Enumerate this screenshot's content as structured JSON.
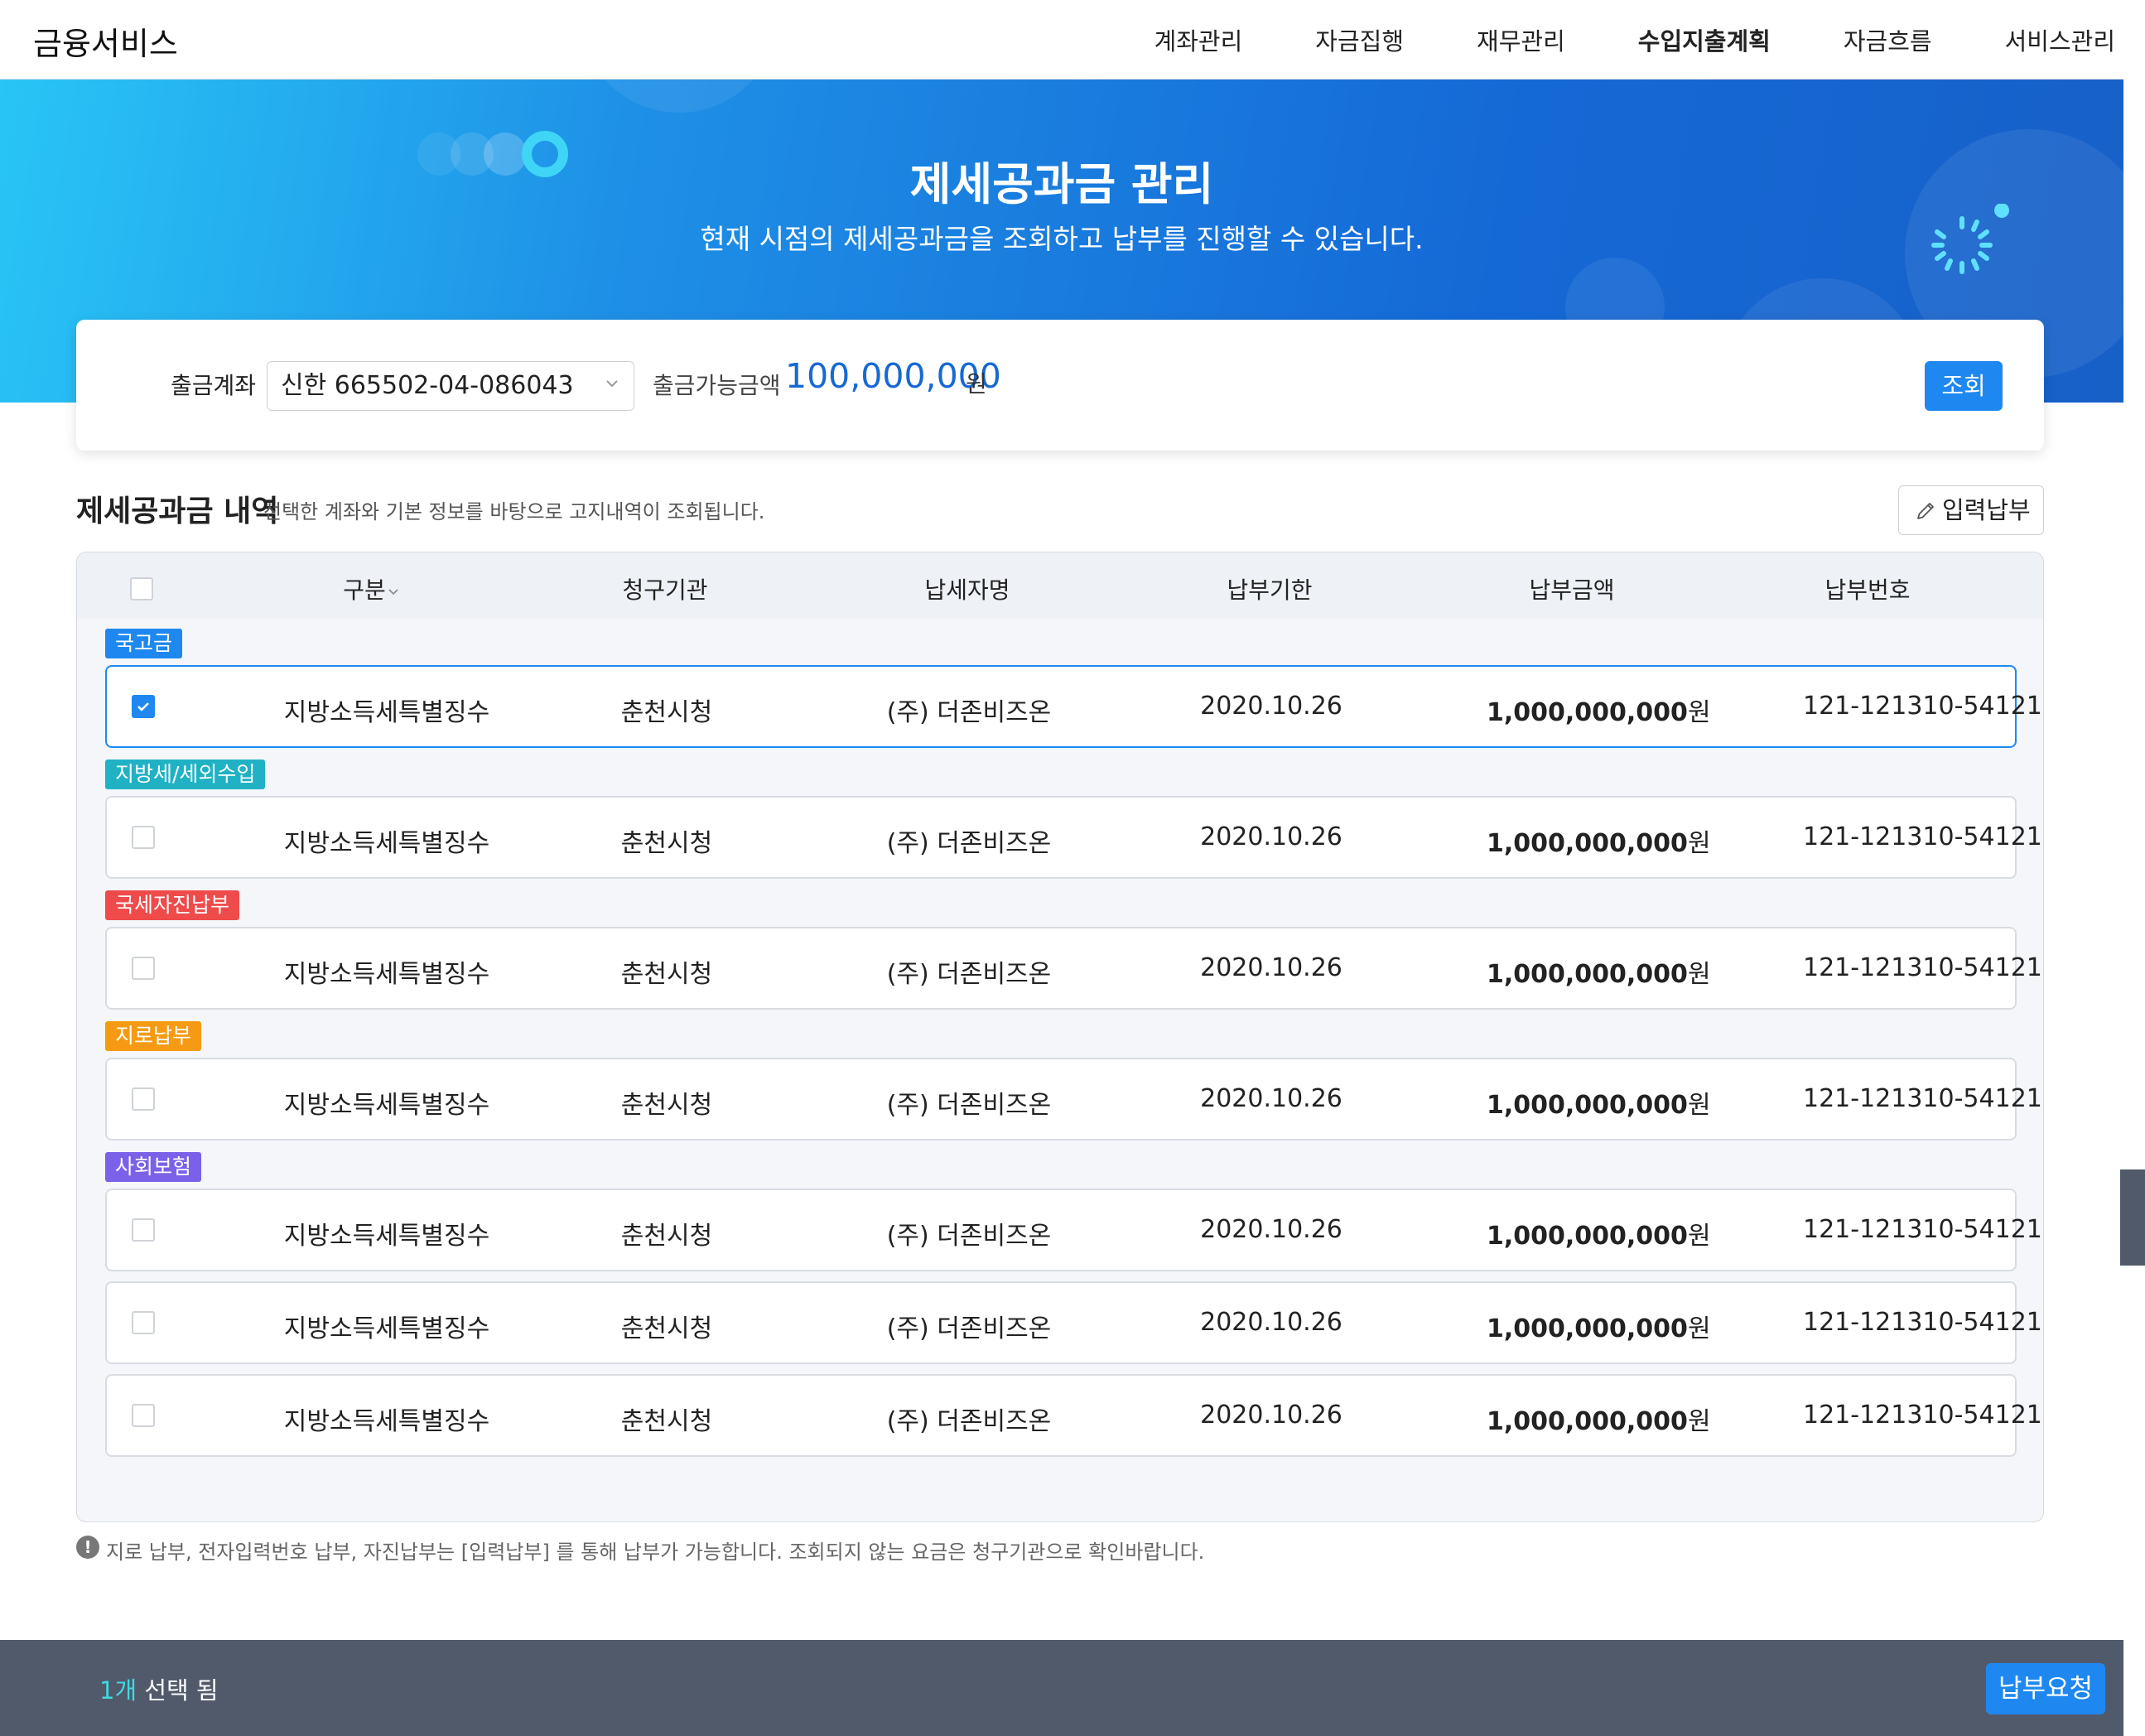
{
  "header": {
    "logo": "금융서비스",
    "nav": [
      "계좌관리",
      "자금집행",
      "재무관리",
      "수입지출계획",
      "자금흐름",
      "서비스관리"
    ],
    "active_nav": "수입지출계획"
  },
  "hero": {
    "title": "제세공과금 관리",
    "subtitle": "현재 시점의 제세공과금을 조회하고 납부를 진행할 수 있습니다."
  },
  "filter": {
    "account_label": "출금계좌",
    "account_value": "신한 665502-04-086043",
    "available_label": "출금가능금액",
    "available_amount": "100,000,000",
    "available_unit": "원",
    "search_button": "조회"
  },
  "section": {
    "title": "제세공과금 내역",
    "description": "선택한 계좌와 기본 정보를 바탕으로 고지내역이 조회됩니다.",
    "input_pay_button": "입력납부"
  },
  "table": {
    "columns": [
      "구분",
      "청구기관",
      "납세자명",
      "납부기한",
      "납부금액",
      "납부번호"
    ],
    "groups": [
      {
        "badge": "국고금",
        "color": "#1e88f0",
        "rows": [
          {
            "checked": true,
            "category": "지방소득세특별징수",
            "agency": "춘천시청",
            "payer": "(주) 더존비즈온",
            "due": "2020.10.26",
            "amount": "1,000,000,000",
            "unit": "원",
            "number": "121-121310-54121"
          }
        ]
      },
      {
        "badge": "지방세/세외수입",
        "color": "#20b2c4",
        "rows": [
          {
            "checked": false,
            "category": "지방소득세특별징수",
            "agency": "춘천시청",
            "payer": "(주) 더존비즈온",
            "due": "2020.10.26",
            "amount": "1,000,000,000",
            "unit": "원",
            "number": "121-121310-54121"
          }
        ]
      },
      {
        "badge": "국세자진납부",
        "color": "#ef4b4b",
        "rows": [
          {
            "checked": false,
            "category": "지방소득세특별징수",
            "agency": "춘천시청",
            "payer": "(주) 더존비즈온",
            "due": "2020.10.26",
            "amount": "1,000,000,000",
            "unit": "원",
            "number": "121-121310-54121"
          }
        ]
      },
      {
        "badge": "지로납부",
        "color": "#f59a12",
        "rows": [
          {
            "checked": false,
            "category": "지방소득세특별징수",
            "agency": "춘천시청",
            "payer": "(주) 더존비즈온",
            "due": "2020.10.26",
            "amount": "1,000,000,000",
            "unit": "원",
            "number": "121-121310-54121"
          }
        ]
      },
      {
        "badge": "사회보험",
        "color": "#7b61e8",
        "rows": [
          {
            "checked": false,
            "category": "지방소득세특별징수",
            "agency": "춘천시청",
            "payer": "(주) 더존비즈온",
            "due": "2020.10.26",
            "amount": "1,000,000,000",
            "unit": "원",
            "number": "121-121310-54121"
          },
          {
            "checked": false,
            "category": "지방소득세특별징수",
            "agency": "춘천시청",
            "payer": "(주) 더존비즈온",
            "due": "2020.10.26",
            "amount": "1,000,000,000",
            "unit": "원",
            "number": "121-121310-54121"
          },
          {
            "checked": false,
            "category": "지방소득세특별징수",
            "agency": "춘천시청",
            "payer": "(주) 더존비즈온",
            "due": "2020.10.26",
            "amount": "1,000,000,000",
            "unit": "원",
            "number": "121-121310-54121"
          }
        ]
      }
    ]
  },
  "notice": "지로 납부, 전자입력번호 납부, 자진납부는 [입력납부] 를 통해 납부가 가능합니다. 조회되지 않는 요금은 청구기관으로 확인바랍니다.",
  "bottom": {
    "count": "1개",
    "count_suffix": " 선택 됨",
    "pay_button": "납부요청"
  },
  "colors": {
    "accent": "#1e88f0",
    "amount_blue": "#1669d2",
    "bottom_bar": "#505a6b",
    "count_cyan": "#3ddbe0"
  }
}
